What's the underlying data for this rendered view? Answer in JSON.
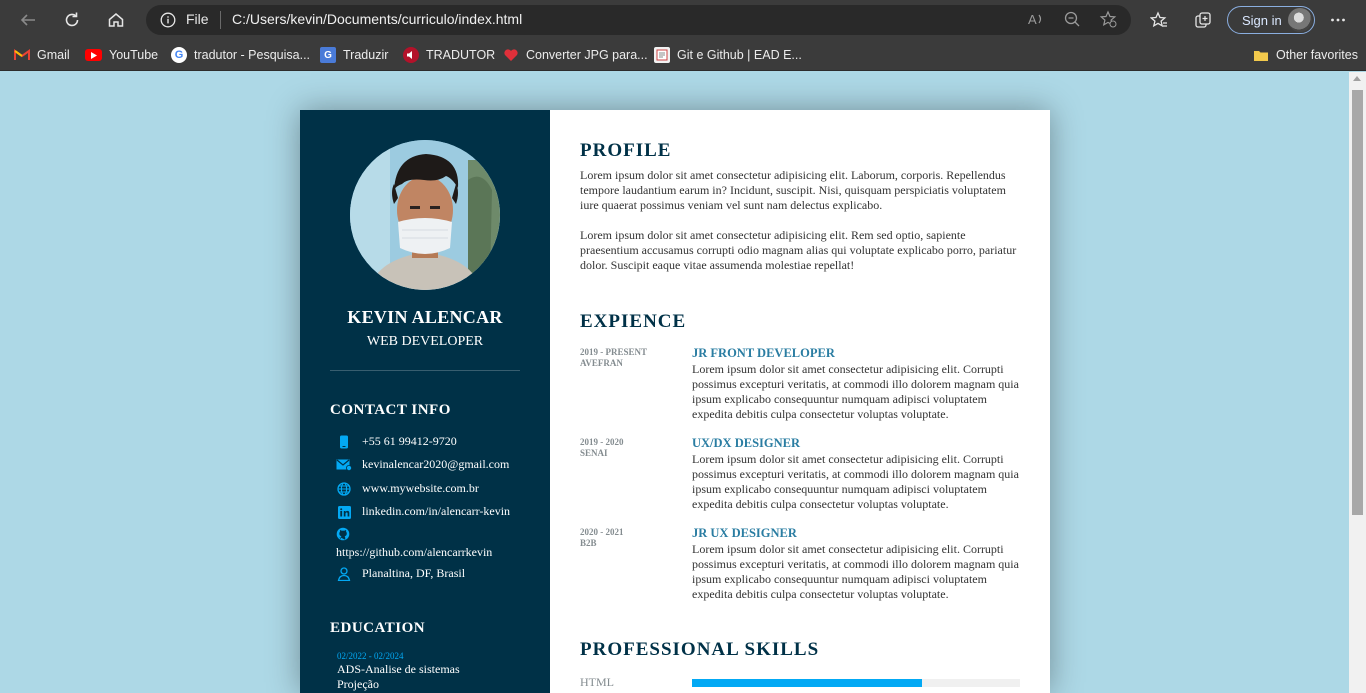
{
  "browser": {
    "address": {
      "scheme_label": "File",
      "url": "C:/Users/kevin/Documents/curriculo/index.html"
    },
    "sign_in_label": "Sign in",
    "bookmarks": [
      {
        "label": "Gmail",
        "icon": "gmail-icon"
      },
      {
        "label": "YouTube",
        "icon": "youtube-icon"
      },
      {
        "label": "tradutor - Pesquisa...",
        "icon": "google-icon"
      },
      {
        "label": "Traduzir",
        "icon": "translate-icon"
      },
      {
        "label": "TRADUTOR",
        "icon": "speaker-icon"
      },
      {
        "label": "Converter JPG para...",
        "icon": "heart-icon"
      },
      {
        "label": "Git e Github | EAD E...",
        "icon": "page-icon"
      }
    ],
    "other_favorites": "Other favorites"
  },
  "resume": {
    "name": "KEVIN ALENCAR",
    "role": "WEB DEVELOPER",
    "contact_title": "CONTACT INFO",
    "contacts": [
      {
        "icon": "phone-icon",
        "text": "+55 61 99412-9720"
      },
      {
        "icon": "email-icon",
        "text": "kevinalencar2020@gmail.com"
      },
      {
        "icon": "globe-icon",
        "text": "www.mywebsite.com.br"
      },
      {
        "icon": "linkedin-icon",
        "text": "linkedin.com/in/alencarr-kevin"
      },
      {
        "icon": "github-icon",
        "text": "https://github.com/alencarrkevin"
      },
      {
        "icon": "location-icon",
        "text": "Planaltina, DF, Brasil"
      }
    ],
    "education_title": "EDUCATION",
    "education": {
      "years": "02/2022 - 02/2024",
      "course": "ADS-Analise de sistemas",
      "school": "Projeção"
    },
    "profile_title": "PROFILE",
    "profile_paragraphs": [
      "Lorem ipsum dolor sit amet consectetur adipisicing elit. Laborum, corporis. Repellendus tempore laudantium earum in? Incidunt, suscipit. Nisi, quisquam perspiciatis voluptatem iure quaerat possimus veniam vel sunt nam delectus explicabo.",
      "Lorem ipsum dolor sit amet consectetur adipisicing elit. Rem sed optio, sapiente praesentium accusamus corrupti odio magnam alias qui voluptate explicabo porro, pariatur dolor. Suscipit eaque vitae assumenda molestiae repellat!"
    ],
    "experience_title": "EXPIENCE",
    "experience": [
      {
        "period": "2019 - PRESENT",
        "org": "AVEFRAN",
        "title": "JR FRONT DEVELOPER",
        "text": "Lorem ipsum dolor sit amet consectetur adipisicing elit. Corrupti possimus excepturi veritatis, at commodi illo dolorem magnam quia ipsum explicabo consequuntur numquam adipisci voluptatem expedita debitis culpa consectetur voluptas voluptate."
      },
      {
        "period": "2019 - 2020",
        "org": "SENAI",
        "title": "UX/DX DESIGNER",
        "text": "Lorem ipsum dolor sit amet consectetur adipisicing elit. Corrupti possimus excepturi veritatis, at commodi illo dolorem magnam quia ipsum explicabo consequuntur numquam adipisci voluptatem expedita debitis culpa consectetur voluptas voluptate."
      },
      {
        "period": "2020 - 2021",
        "org": "B2B",
        "title": "JR UX DESIGNER",
        "text": "Lorem ipsum dolor sit amet consectetur adipisicing elit. Corrupti possimus excepturi veritatis, at commodi illo dolorem magnam quia ipsum explicabo consequuntur numquam adipisci voluptatem expedita debitis culpa consectetur voluptas voluptate."
      }
    ],
    "skills_title": "PROFESSIONAL SKILLS",
    "skills": [
      {
        "name": "HTML",
        "level_percent": 70
      }
    ]
  },
  "colors": {
    "page_background": "#add8e6",
    "sidebar": "#003147",
    "accent": "#03a9f4",
    "job_title": "#2a7da2"
  }
}
